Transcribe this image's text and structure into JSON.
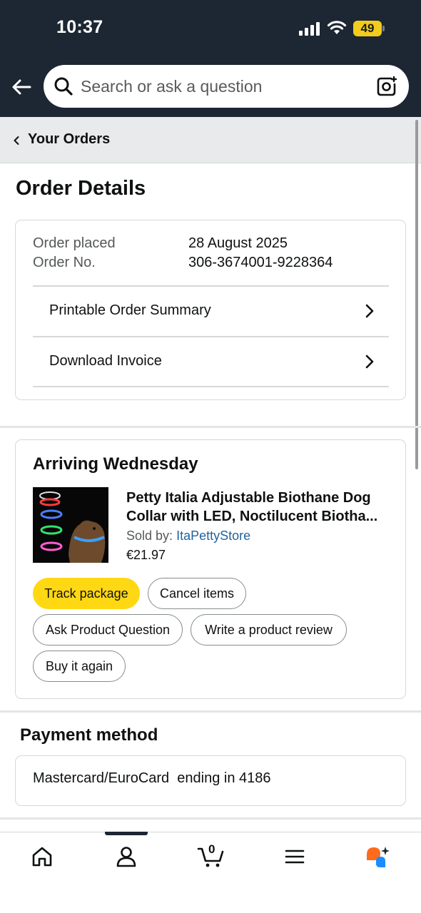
{
  "status_bar": {
    "time": "10:37",
    "battery": "49"
  },
  "search": {
    "placeholder": "Search or ask a question"
  },
  "breadcrumb": {
    "label": "Your Orders"
  },
  "page": {
    "title": "Order Details"
  },
  "order_summary": {
    "placed_label": "Order placed",
    "placed_value": "28 August 2025",
    "number_label": "Order No.",
    "number_value": "306-3674001-9228364",
    "links": [
      {
        "label": "Printable Order Summary"
      },
      {
        "label": "Download Invoice"
      }
    ]
  },
  "shipment": {
    "heading": "Arriving Wednesday",
    "product": {
      "title_line1": "Petty Italia Adjustable Biothane Dog",
      "title_line2": "Collar with LED, Noctilucent Biotha...",
      "sold_by_label": "Sold by:",
      "seller": "ItaPettyStore",
      "price": "€21.97"
    },
    "actions": {
      "track": "Track package",
      "cancel": "Cancel items",
      "ask": "Ask Product Question",
      "review": "Write a product review",
      "buy_again": "Buy it again"
    }
  },
  "payment": {
    "heading": "Payment method",
    "text": "Mastercard/EuroCard  ending in 4186"
  },
  "bottom_nav": {
    "items": [
      "home-icon",
      "account-icon",
      "cart-icon",
      "menu-icon",
      "rufus-icon"
    ],
    "cart_count": "0"
  },
  "colors": {
    "header_bg": "#1d2633",
    "primary_button": "#ffd814",
    "link": "#2162a1",
    "battery": "#f2cc1c"
  }
}
